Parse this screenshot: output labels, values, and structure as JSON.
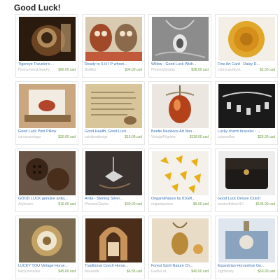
{
  "page": {
    "title": "Good Luck!"
  },
  "items": [
    {
      "title": "Tigereye Traveler's ...",
      "shop": "PhenomenalJewelry",
      "price": "$66.00 usd"
    },
    {
      "title": "Ready to S H I P whoot...",
      "shop": "Bwilliks",
      "price": "$34.00 usd"
    },
    {
      "title": "Willow - Good Luck Wish...",
      "shop": "PhoenixGlasba",
      "price": "$28.00 usd"
    },
    {
      "title": "Fine Art Card - Daisy D...",
      "shop": "cathycasebyck",
      "price": "$3.50 usd"
    },
    {
      "title": "Good Luck Print Pillow",
      "shop": "carossaintiago",
      "price": "$30.00 usd"
    },
    {
      "title": "Good Health, Good Luck ...",
      "shop": "saintbradesign",
      "price": "$15.00 usd"
    },
    {
      "title": "Beetle Necklace Art Nou...",
      "shop": "VintagePilgrime",
      "price": "$118.00 usd"
    },
    {
      "title": "Lucky charm bracelet - ...",
      "shop": "cutsandfun",
      "price": "$25.00 usd"
    },
    {
      "title": "GOOD LUCK genuine antiq...",
      "shop": "Ailybeans",
      "price": "$16.00 usd"
    },
    {
      "title": "Anita - Sterling Silver...",
      "shop": "PhoenixGlasba",
      "price": "$30.00 usd"
    },
    {
      "title": "OrigamiPalace by 81Gift...",
      "shop": "origamipalace",
      "price": "$5.00 usd"
    },
    {
      "title": "Good Luck Deluxe Clutch",
      "shop": "westeeffabent10",
      "price": "$195.00 usd"
    },
    {
      "title": "LUCKY YOU Vintage Horse...",
      "shop": "kellycoeesdes",
      "price": "$45.00 usd"
    },
    {
      "title": "Traditional Czech Horse...",
      "shop": "houseofk",
      "price": "$6.55 usd"
    },
    {
      "title": "Forest Spirit Nature Ch...",
      "shop": "FaerieLet",
      "price": "$40.00 usd"
    },
    {
      "title": "Equestrian Horseshoe Go...",
      "shop": "ZigHorsey",
      "price": "$60.00 usd"
    }
  ]
}
